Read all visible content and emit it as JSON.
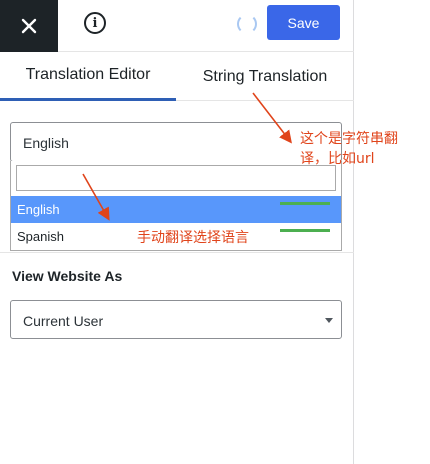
{
  "topbar": {
    "save_label": "Save"
  },
  "tabs": [
    {
      "label": "Translation Editor",
      "active": true
    },
    {
      "label": "String Translation",
      "active": false
    }
  ],
  "language_select": {
    "selected": "English",
    "search_value": "",
    "options": [
      {
        "label": "English",
        "highlighted": true
      },
      {
        "label": "Spanish",
        "highlighted": false
      }
    ]
  },
  "view_as": {
    "title": "View Website As",
    "selected": "Current User"
  },
  "annotations": {
    "note_string": "这个是字符串翻译，比如url",
    "note_manual": "手动翻译选择语言",
    "color": "#e0441b"
  },
  "colors": {
    "accent": "#3a67e8",
    "highlight": "#5897fb",
    "dark": "#1d2327"
  },
  "icons": [
    "close-icon",
    "info-icon",
    "loading-spinner-icon",
    "caret-down-icon"
  ]
}
